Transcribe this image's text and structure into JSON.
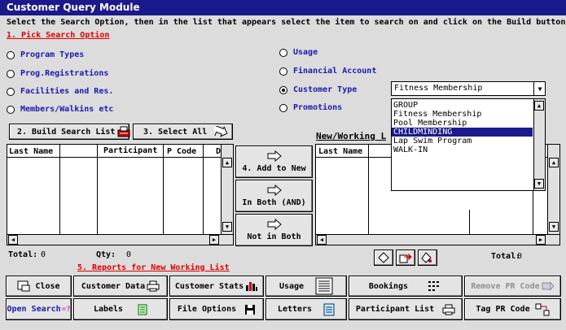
{
  "window": {
    "title": "Customer Query Module"
  },
  "instructions": "Select the Search Option, then in the list that appears select the item to search on and click on the Build button",
  "step1": "1. Pick Search Option",
  "options_left": [
    "Program Types",
    "Prog.Registrations",
    "Facilities and Res.",
    "Members/Walkins etc"
  ],
  "options_right": [
    "Usage",
    "Financial Account",
    "Customer Type",
    "Promotions"
  ],
  "selected_option": "Customer Type",
  "dropdown": {
    "value": "Fitness Membership",
    "items": [
      "GROUP",
      "Fitness Membership",
      "Pool Membership",
      "CHILDMINDING",
      "Lap Swim Program",
      "WALK-IN"
    ],
    "highlighted": "CHILDMINDING"
  },
  "buttons": {
    "build": "2. Build Search List",
    "select_all": "3. Select All",
    "add_new": "4. Add to New",
    "in_both": "In Both (AND)",
    "not_both": "Not in Both"
  },
  "left_list": {
    "headers": [
      "Last Name",
      "",
      "Participant",
      "P Code",
      "D"
    ]
  },
  "right_list": {
    "title": "New/Working L",
    "headers": [
      "Last Name"
    ]
  },
  "totals": {
    "total_label": "Total:",
    "total_value": "0",
    "qty_label": "Qty:",
    "qty_value": "0",
    "right_total_label": "Total:",
    "right_total_value": "0"
  },
  "step5": "5. Reports for New Working List",
  "bottom_row1": [
    "Close",
    "Customer Data",
    "Customer Stats",
    "Usage",
    "Bookings",
    "Remove PR Code"
  ],
  "bottom_row2": [
    "Open Search",
    "Labels",
    "File Options",
    "Letters",
    "Participant List",
    "Tag PR Code"
  ],
  "colors": {
    "title_bg": "#1a1a8c",
    "option_text": "#1a1ab0",
    "step_text": "#e00000",
    "disabled_text": "#909090"
  }
}
